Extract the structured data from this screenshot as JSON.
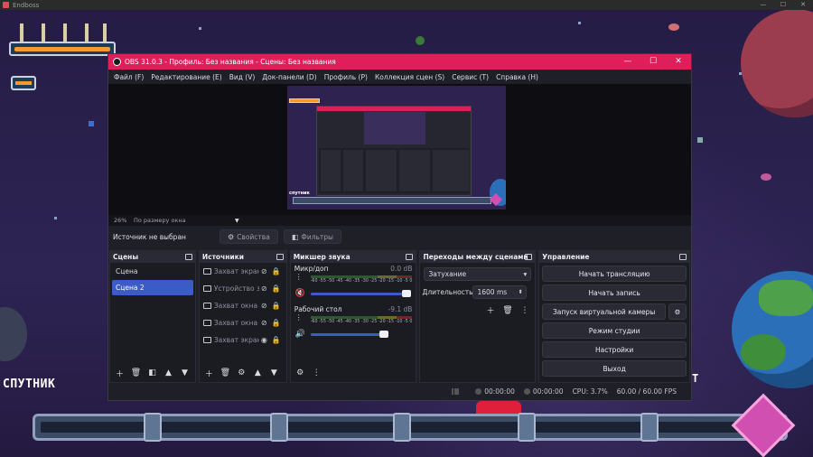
{
  "outer_window": {
    "title": "Endboss"
  },
  "desktop": {
    "sputnik_label": "СПУТНИК",
    "tee_glyph": "T"
  },
  "obs": {
    "title": "OBS 31.0.3 - Профиль: Без названия - Сцены: Без названия",
    "menu": [
      "Файл (F)",
      "Редактирование (E)",
      "Вид (V)",
      "Док-панели (D)",
      "Профиль (P)",
      "Коллекция сцен (S)",
      "Сервис (T)",
      "Справка (H)"
    ],
    "preview": {
      "zoom": "26%",
      "fit_mode": "По размеру окна",
      "preview_label": "спутник"
    },
    "source_bar": {
      "no_source": "Источник не выбран",
      "properties": "Свойства",
      "filters": "Фильтры"
    },
    "scenes": {
      "title": "Сцены",
      "items": [
        "Сцена",
        "Сцена 2"
      ],
      "selected_index": 1
    },
    "sources": {
      "title": "Источники",
      "items": [
        {
          "label": "Захват экран",
          "icon": "monitor-icon"
        },
        {
          "label": "Устройство з",
          "icon": "camera-icon"
        },
        {
          "label": "Захват окна",
          "icon": "window-icon"
        },
        {
          "label": "Захват окна",
          "icon": "window-icon"
        },
        {
          "label": "Захват экран",
          "icon": "monitor-icon"
        }
      ]
    },
    "mixer": {
      "title": "Микшер звука",
      "scale": [
        "-60",
        "-55",
        "-50",
        "-45",
        "-40",
        "-35",
        "-30",
        "-25",
        "-20",
        "-15",
        "-10",
        "-5",
        "0"
      ],
      "channels": [
        {
          "name": "Микр/доп",
          "db": "0.0 dB",
          "muted": true,
          "level": 0.95
        },
        {
          "name": "Рабочий стол",
          "db": "-9.1 dB",
          "muted": false,
          "level": 0.75
        }
      ]
    },
    "transitions": {
      "title": "Переходы между сценами",
      "selected": "Затухание",
      "duration_label": "Длительность",
      "duration_value": "1600 ms"
    },
    "controls": {
      "title": "Управление",
      "start_stream": "Начать трансляцию",
      "start_record": "Начать запись",
      "virtual_cam": "Запуск виртуальной камеры",
      "studio_mode": "Режим студии",
      "settings": "Настройки",
      "exit": "Выход"
    },
    "status": {
      "stream_time": "00:00:00",
      "rec_time": "00:00:00",
      "cpu": "CPU: 3.7%",
      "fps": "60.00 / 60.00 FPS"
    }
  },
  "colors": {
    "accent": "#e01e5a",
    "selection": "#3b5bc7"
  }
}
